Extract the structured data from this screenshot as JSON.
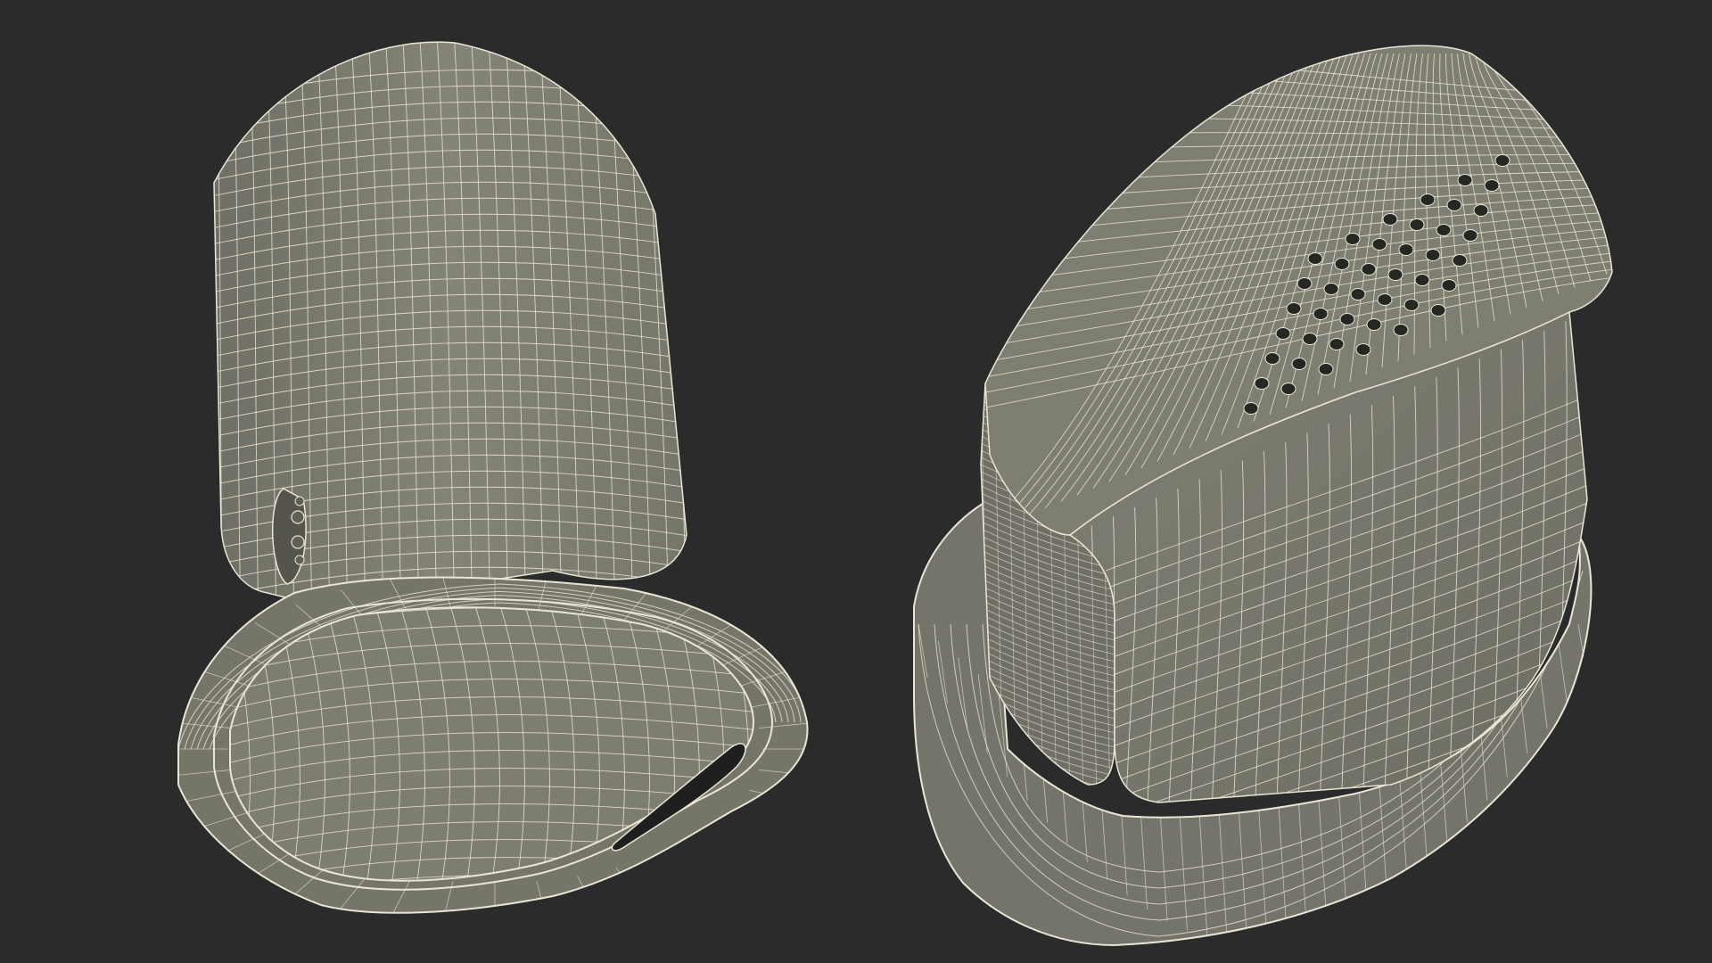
{
  "scene": {
    "background_color": "#2b2b2b",
    "surface_color": "#7b7b70",
    "surface_shadow_color": "#66665d",
    "wire_color": "#e9e6d6",
    "views": [
      {
        "name": "device-view-bottom",
        "description_icon": "wireframe-model-icon"
      },
      {
        "name": "device-view-top",
        "description_icon": "wireframe-model-icon"
      }
    ]
  }
}
